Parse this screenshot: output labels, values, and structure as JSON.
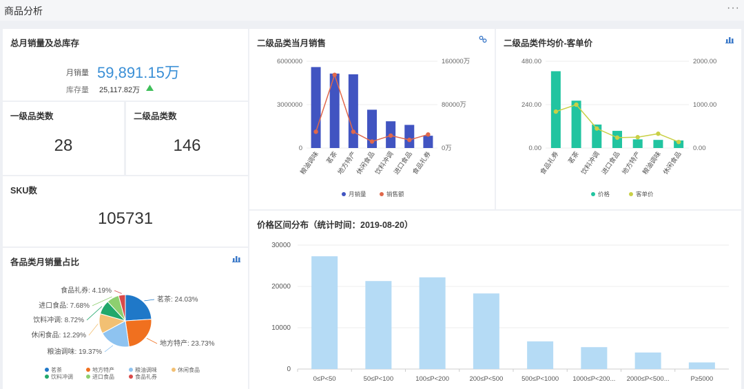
{
  "header": {
    "title": "商品分析",
    "more": "···"
  },
  "summary": {
    "title": "总月销量及总库存",
    "sales_label": "月销量",
    "sales_value": "59,891.15万",
    "stock_label": "库存量",
    "stock_value": "25,117.82万",
    "trend": "up"
  },
  "kpi1": {
    "title": "一级品类数",
    "value": "28"
  },
  "kpi2": {
    "title": "二级品类数",
    "value": "146"
  },
  "kpi3": {
    "title": "SKU数",
    "value": "105731"
  },
  "pie_card": {
    "title": "各品类月销量占比"
  },
  "bar_card": {
    "title": "二级品类当月销售"
  },
  "avg_card": {
    "title": "二级品类件均价-客单价"
  },
  "hist_card": {
    "title": "价格区间分布（统计时间：2019-08-20）"
  },
  "colors": {
    "blue": "#4154c1",
    "orange": "#e0684b",
    "teal": "#21c4a0",
    "yellow": "#c9d046",
    "light": "#b5dbf5",
    "value": "#3a8fd6"
  },
  "chart_data": [
    {
      "type": "pie",
      "categories": [
        "茗茶",
        "地方特产",
        "粮油调味",
        "休闲食品",
        "饮料冲调",
        "进口食品",
        "食品礼券"
      ],
      "values": [
        24.03,
        23.73,
        19.37,
        12.29,
        8.72,
        7.68,
        4.19
      ],
      "labels": [
        "茗茶: 24.03%",
        "地方特产: 23.73%",
        "粮油调味: 19.37%",
        "休闲食品: 12.29%",
        "饮料冲调: 8.72%",
        "进口食品: 7.68%",
        "食品礼券: 4.19%"
      ],
      "colors": [
        "#1f78c8",
        "#f0701f",
        "#8ec3f0",
        "#f2c073",
        "#21a86b",
        "#8dcf6f",
        "#d94a4a"
      ],
      "legend": "bottom"
    },
    {
      "type": "bar",
      "categories": [
        "粮油调味",
        "茗茶",
        "地方特产",
        "休闲食品",
        "饮料冲调",
        "进口食品",
        "食品礼券"
      ],
      "series": [
        {
          "name": "月销量",
          "type": "bar",
          "values": [
            5600000,
            5150000,
            5100000,
            2650000,
            1850000,
            1600000,
            850000
          ]
        },
        {
          "name": "销售额",
          "type": "line",
          "axis": "right",
          "values": [
            30000,
            135000,
            30000,
            12000,
            23000,
            15000,
            25000
          ]
        }
      ],
      "yticks_left": [
        "6000000",
        "3000000",
        "0"
      ],
      "yticks_right": [
        "160000万",
        "80000万",
        "0万"
      ],
      "ylim_left": [
        0,
        6000000
      ],
      "ylim_right": [
        0,
        160000
      ],
      "legend": "bottom"
    },
    {
      "type": "bar",
      "categories": [
        "食品礼券",
        "茗茶",
        "饮料冲调",
        "进口食品",
        "地方特产",
        "粮油调味",
        "休闲食品"
      ],
      "series": [
        {
          "name": "价格",
          "type": "bar",
          "values": [
            425,
            262,
            130,
            95,
            48,
            45,
            42
          ]
        },
        {
          "name": "客单价",
          "type": "line",
          "axis": "right",
          "values": [
            840,
            1000,
            450,
            240,
            250,
            330,
            140
          ]
        }
      ],
      "yticks_left": [
        "480.00",
        "240.00",
        "0.00"
      ],
      "yticks_right": [
        "2000.00",
        "1000.00",
        "0.00"
      ],
      "ylim_left": [
        0,
        480
      ],
      "ylim_right": [
        0,
        2000
      ],
      "legend": "bottom"
    },
    {
      "type": "bar",
      "categories": [
        "0≤P<50",
        "50≤P<100",
        "100≤P<200",
        "200≤P<500",
        "500≤P<1000",
        "1000≤P<200...",
        "2000≤P<500...",
        "P≥5000"
      ],
      "values": [
        27300,
        21300,
        22200,
        18300,
        6700,
        5300,
        4000,
        1600
      ],
      "yticks": [
        "30000",
        "20000",
        "10000",
        "0"
      ],
      "ylim": [
        0,
        30000
      ]
    }
  ]
}
